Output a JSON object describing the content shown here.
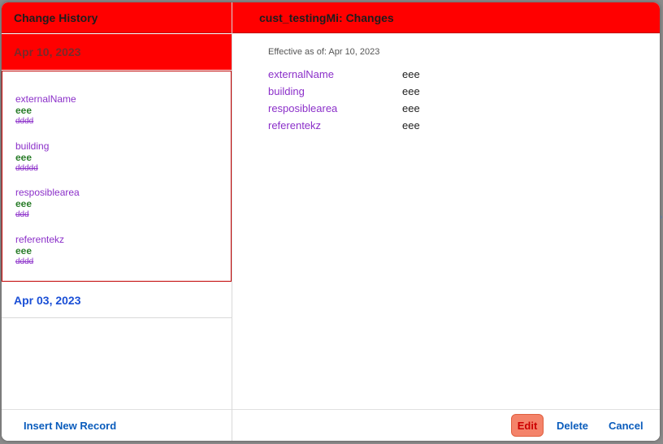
{
  "left": {
    "title": "Change History",
    "selected_date": "Apr 10, 2023",
    "changes": [
      {
        "field": "externalName",
        "new": "eee",
        "old": "dddd"
      },
      {
        "field": "building",
        "new": "eee",
        "old": "ddddd"
      },
      {
        "field": "resposiblearea",
        "new": "eee",
        "old": "ddd"
      },
      {
        "field": "referentekz",
        "new": "eee",
        "old": "dddd"
      }
    ],
    "other_date": "Apr 03, 2023",
    "insert_label": "Insert New Record"
  },
  "right": {
    "title": "cust_testingMi: Changes",
    "effective": "Effective as of: Apr 10, 2023",
    "rows": [
      {
        "field": "externalName",
        "value": "eee"
      },
      {
        "field": "building",
        "value": "eee"
      },
      {
        "field": "resposiblearea",
        "value": "eee"
      },
      {
        "field": "referentekz",
        "value": "eee"
      }
    ],
    "edit_label": "Edit",
    "delete_label": "Delete",
    "cancel_label": "Cancel"
  },
  "colors": {
    "header": "#ff0000",
    "link": "#0a5cbc",
    "field": "#8b2fc9",
    "new_value": "#2a7d2a"
  }
}
